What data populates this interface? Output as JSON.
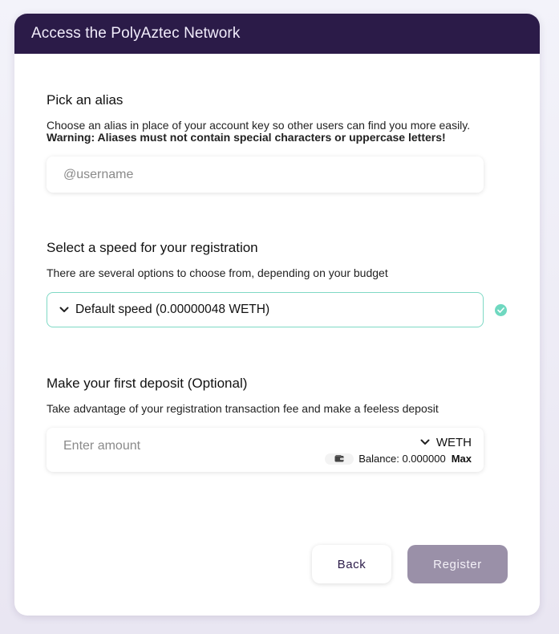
{
  "header": {
    "title": "Access the PolyAztec Network"
  },
  "alias": {
    "title": "Pick an alias",
    "description": "Choose an alias in place of your account key so other users can find you more easily.",
    "warning": "Warning: Aliases must not contain special characters or uppercase letters!",
    "placeholder": "@username",
    "value": ""
  },
  "speed": {
    "title": "Select a speed for your registration",
    "description": "There are several options to choose from, depending on your budget",
    "selected": "Default speed (0.00000048 WETH)",
    "valid": true,
    "accent_color": "#6fd8c0"
  },
  "deposit": {
    "title": "Make your first deposit (Optional)",
    "description": "Take advantage of your registration transaction fee and make a feeless deposit",
    "placeholder": "Enter amount",
    "currency": "WETH",
    "balance_label": "Balance: 0.000000",
    "max_label": "Max"
  },
  "actions": {
    "back_label": "Back",
    "register_label": "Register"
  },
  "colors": {
    "header_bg": "#2b1b48",
    "register_bg": "#9a90a8",
    "select_border": "#7fd9c5"
  },
  "icons": {
    "select": "chevron-down-icon",
    "currency": "chevron-down-icon",
    "wallet": "wallet-icon",
    "check": "check-icon"
  }
}
